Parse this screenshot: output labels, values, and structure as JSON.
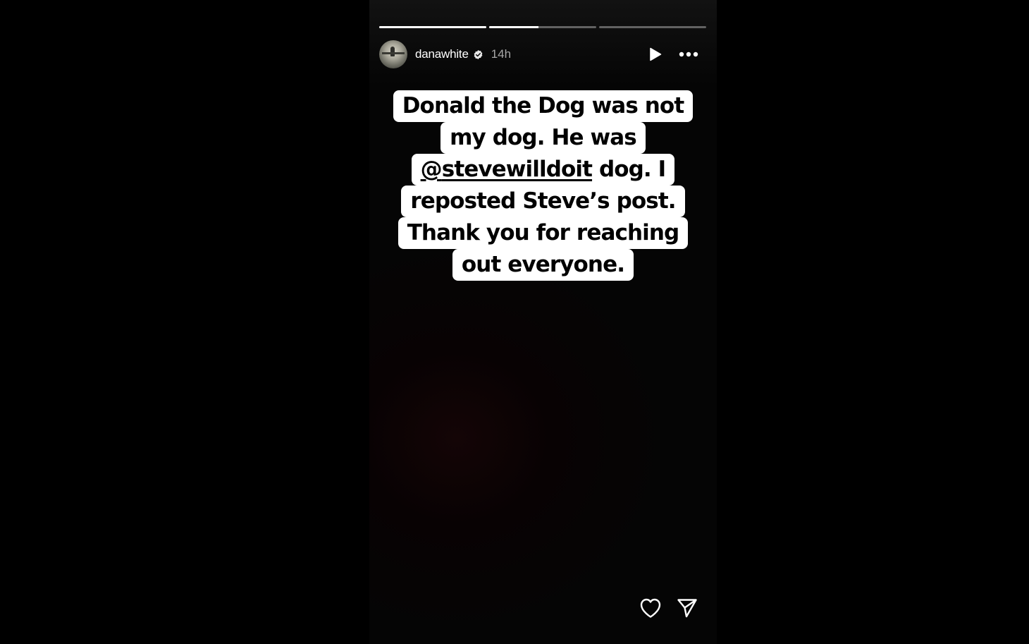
{
  "story": {
    "progress_segments": [
      {
        "label": "segment-1",
        "fill": 1.0
      },
      {
        "label": "segment-2",
        "fill": 0.46
      },
      {
        "label": "segment-3",
        "fill": 0.0
      }
    ],
    "username": "danawhite",
    "verified": true,
    "time_ago": "14h",
    "caption_lines": [
      "Donald the Dog was not",
      "my dog. He was",
      "",
      "reposted Steve’s post.",
      "Thank you for reaching",
      "out everyone."
    ],
    "mention_icon": "@",
    "mention_handle": "stevewilldoit",
    "mention_line_suffix": " dog. I"
  },
  "icons": {
    "play": "play-icon",
    "more": "more-options-icon",
    "like": "heart-icon",
    "share": "send-icon",
    "verified": "verified-badge-icon"
  },
  "colors": {
    "background": "#000000",
    "story_background": "#050505",
    "caption_box": "#ffffff",
    "caption_text": "#000000",
    "time_text": "#a8a8a8",
    "progress_active": "#ffffff"
  }
}
